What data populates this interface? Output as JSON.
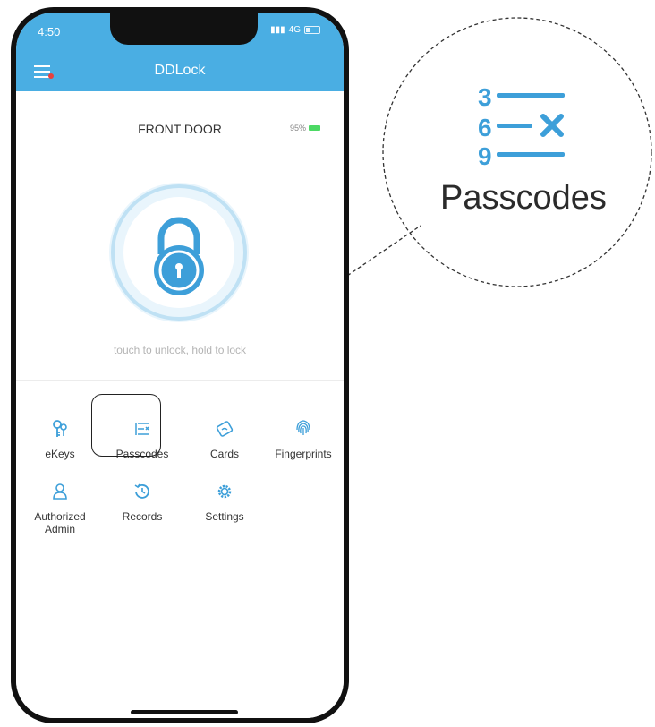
{
  "status": {
    "time": "4:50",
    "network": "4G"
  },
  "app": {
    "title": "DDLock"
  },
  "lock": {
    "door_name": "FRONT DOOR",
    "battery": "95%",
    "hint": "touch to unlock, hold to lock"
  },
  "menu": {
    "items": [
      {
        "label": "eKeys",
        "icon": "ekey-icon"
      },
      {
        "label": "Passcodes",
        "icon": "passcode-icon"
      },
      {
        "label": "Cards",
        "icon": "card-icon"
      },
      {
        "label": "Fingerprints",
        "icon": "fingerprint-icon"
      },
      {
        "label": "Authorized\nAdmin",
        "icon": "admin-icon"
      },
      {
        "label": "Records",
        "icon": "records-icon"
      },
      {
        "label": "Settings",
        "icon": "gear-icon"
      }
    ]
  },
  "callout": {
    "label": "Passcodes",
    "digits": [
      "3",
      "6",
      "9"
    ]
  },
  "colors": {
    "accent": "#4aaee3",
    "lock_blue": "#3d9fd9",
    "battery_green": "#4cd964"
  }
}
